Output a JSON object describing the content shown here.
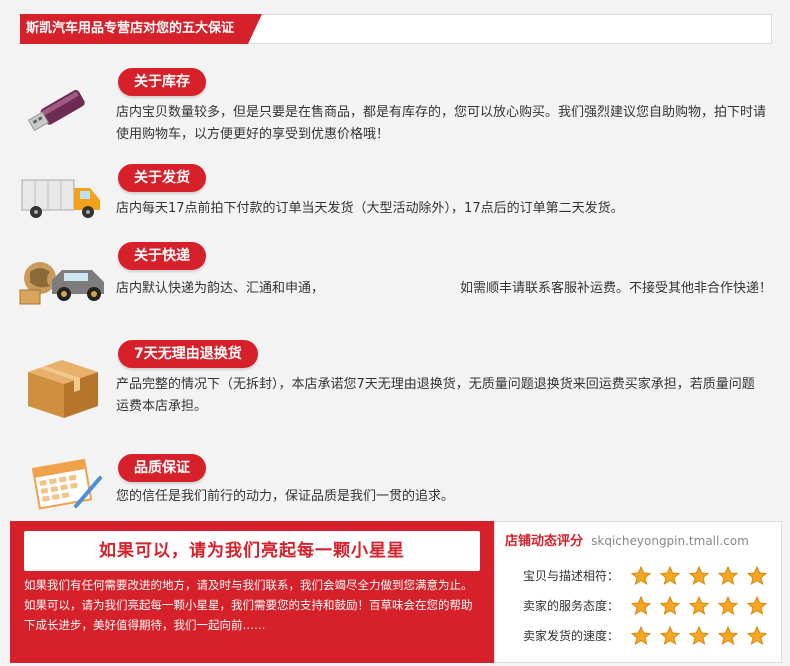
{
  "header": {
    "title": "斯凯汽车用品专营店对您的五大保证"
  },
  "sections": [
    {
      "label": "关于库存",
      "text": "店内宝贝数量较多，但是只要是在售商品，都是有库存的，您可以放心购买。我们强烈建议您自助购物，拍下时请使用购物车，以方便更好的享受到优惠价格哦！",
      "icon": "usb-drive-icon"
    },
    {
      "label": "关于发货",
      "text": "店内每天17点前拍下付款的订单当天发货（大型活动除外），17点后的订单第二天发货。",
      "icon": "delivery-truck-icon"
    },
    {
      "label": "关于快递",
      "text_a": "店内默认快递为韵达、汇通和申通，",
      "text_b": "如需顺丰请联系客服补运费。不接受其他非合作快递！",
      "icon": "express-car-icon"
    },
    {
      "label": "7天无理由退换货",
      "text": "产品完整的情况下（无拆封），本店承诺您7天无理由退换货，无质量问题退换货来回运费买家承担，若质量问题运费本店承担。",
      "icon": "package-box-icon"
    },
    {
      "label": "品质保证",
      "text": "您的信任是我们前行的动力，保证品质是我们一贯的追求。",
      "icon": "calendar-pen-icon"
    }
  ],
  "appeal": {
    "title": "如果可以，请为我们亮起每一颗小星星",
    "message": "如果我们有任何需要改进的地方，请及时与我们联系，我们会竭尽全力做到您满意为止。如果可以，请为我们亮起每一颗小星星，我们需要您的支持和鼓励！百草味会在您的帮助下成长进步，美好值得期待，我们一起向前……"
  },
  "rating": {
    "title": "店铺动态评分",
    "url": "skqicheyongpin.tmall.com",
    "items": [
      {
        "label": "宝贝与描述相符：",
        "stars": 5
      },
      {
        "label": "卖家的服务态度：",
        "stars": 5
      },
      {
        "label": "卖家发货的速度：",
        "stars": 5
      }
    ]
  },
  "colors": {
    "accent": "#d6202a",
    "star": "#f5a623"
  }
}
